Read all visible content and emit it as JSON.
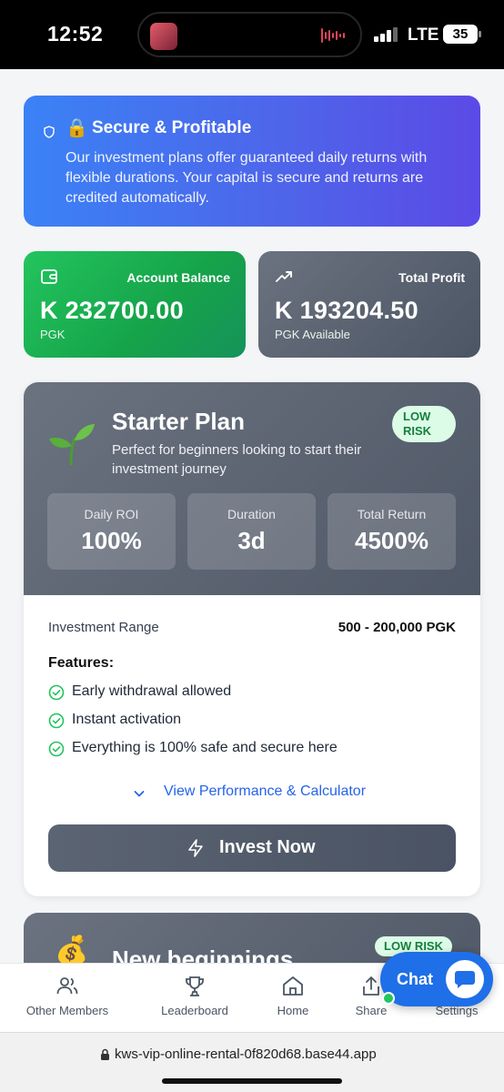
{
  "status_bar": {
    "time": "12:52",
    "network": "LTE",
    "battery": "35"
  },
  "banner": {
    "title": "Secure & Profitable",
    "lock_emoji": "🔒",
    "text": "Our investment plans offer guaranteed daily returns with flexible durations. Your capital is secure and returns are credited automatically."
  },
  "balance_card": {
    "label": "Account Balance",
    "value": "K 232700.00",
    "sub": "PGK",
    "icon": "wallet-icon"
  },
  "profit_card": {
    "label": "Total Profit",
    "value": "K 193204.50",
    "sub": "PGK Available",
    "icon": "trending-up-icon"
  },
  "plan": {
    "name": "Starter Plan",
    "description": "Perfect for beginners looking to start their investment journey",
    "risk_line1": "LOW",
    "risk_line2": "RISK",
    "metrics": [
      {
        "label": "Daily ROI",
        "value": "100%"
      },
      {
        "label": "Duration",
        "value": "3d"
      },
      {
        "label": "Total Return",
        "value": "4500%"
      }
    ],
    "range_label": "Investment Range",
    "range_value": "500 - 200,000 PGK",
    "features_title": "Features:",
    "features": [
      "Early withdrawal allowed",
      "Instant activation",
      "Everything is 100% safe and secure here"
    ],
    "performance_link": "View Performance & Calculator",
    "invest_button": "Invest Now"
  },
  "plan2": {
    "name": "New beginnings",
    "risk": "LOW RISK",
    "emoji": "💰"
  },
  "chat": {
    "label": "Chat"
  },
  "bottom_nav": [
    {
      "label": "Other Members",
      "icon": "users-icon"
    },
    {
      "label": "Leaderboard",
      "icon": "trophy-icon"
    },
    {
      "label": "Home",
      "icon": "home-icon"
    },
    {
      "label": "Share",
      "icon": "share-icon"
    },
    {
      "label": "Settings",
      "icon": "settings-icon"
    }
  ],
  "url": "kws-vip-online-rental-0f820d68.base44.app",
  "colors": {
    "accent_blue": "#2563eb",
    "success_green": "#22c55e",
    "danger_red": "#ef1d1d",
    "plan_gray": "#5b6472"
  }
}
